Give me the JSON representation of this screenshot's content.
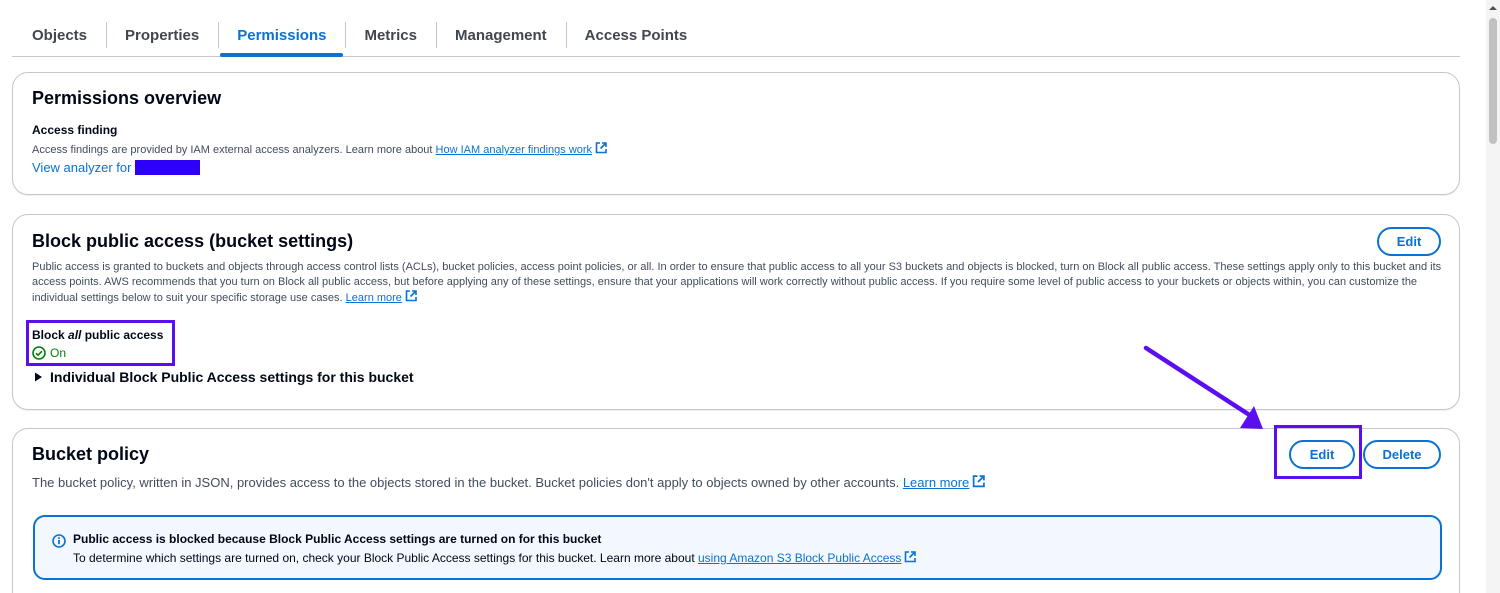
{
  "tabs": [
    {
      "label": "Objects"
    },
    {
      "label": "Properties"
    },
    {
      "label": "Permissions"
    },
    {
      "label": "Metrics"
    },
    {
      "label": "Management"
    },
    {
      "label": "Access Points"
    }
  ],
  "active_tab": "Permissions",
  "permissions_overview": {
    "title": "Permissions overview",
    "access_finding_label": "Access finding",
    "description": "Access findings are provided by IAM external access analyzers. Learn more about ",
    "link": "How IAM analyzer findings work",
    "view_analyzer": "View analyzer for"
  },
  "block_public_access": {
    "title": "Block public access (bucket settings)",
    "edit_label": "Edit",
    "description": "Public access is granted to buckets and objects through access control lists (ACLs), bucket policies, access point policies, or all. In order to ensure that public access to all your S3 buckets and objects is blocked, turn on Block all public access. These settings apply only to this bucket and its access points. AWS recommends that you turn on Block all public access, but before applying any of these settings, ensure that your applications will work correctly without public access. If you require some level of public access to your buckets or objects within, you can customize the individual settings below to suit your specific storage use cases. ",
    "learn_more": "Learn more",
    "block_all_prefix": "Block ",
    "block_all_em": "all",
    "block_all_suffix": " public access",
    "status": "On",
    "individual_settings": "Individual Block Public Access settings for this bucket"
  },
  "bucket_policy": {
    "title": "Bucket policy",
    "edit_label": "Edit",
    "delete_label": "Delete",
    "description": "The bucket policy, written in JSON, provides access to the objects stored in the bucket. Bucket policies don't apply to objects owned by other accounts. ",
    "learn_more": "Learn more",
    "alert_title": "Public access is blocked because Block Public Access settings are turned on for this bucket",
    "alert_body": "To determine which settings are turned on, check your Block Public Access settings for this bucket. Learn more about ",
    "alert_link": "using Amazon S3 Block Public Access"
  },
  "colors": {
    "accent": "#0972d3",
    "success": "#037f0c",
    "annotation": "#5b0ff0",
    "redaction": "#2d00f7"
  }
}
